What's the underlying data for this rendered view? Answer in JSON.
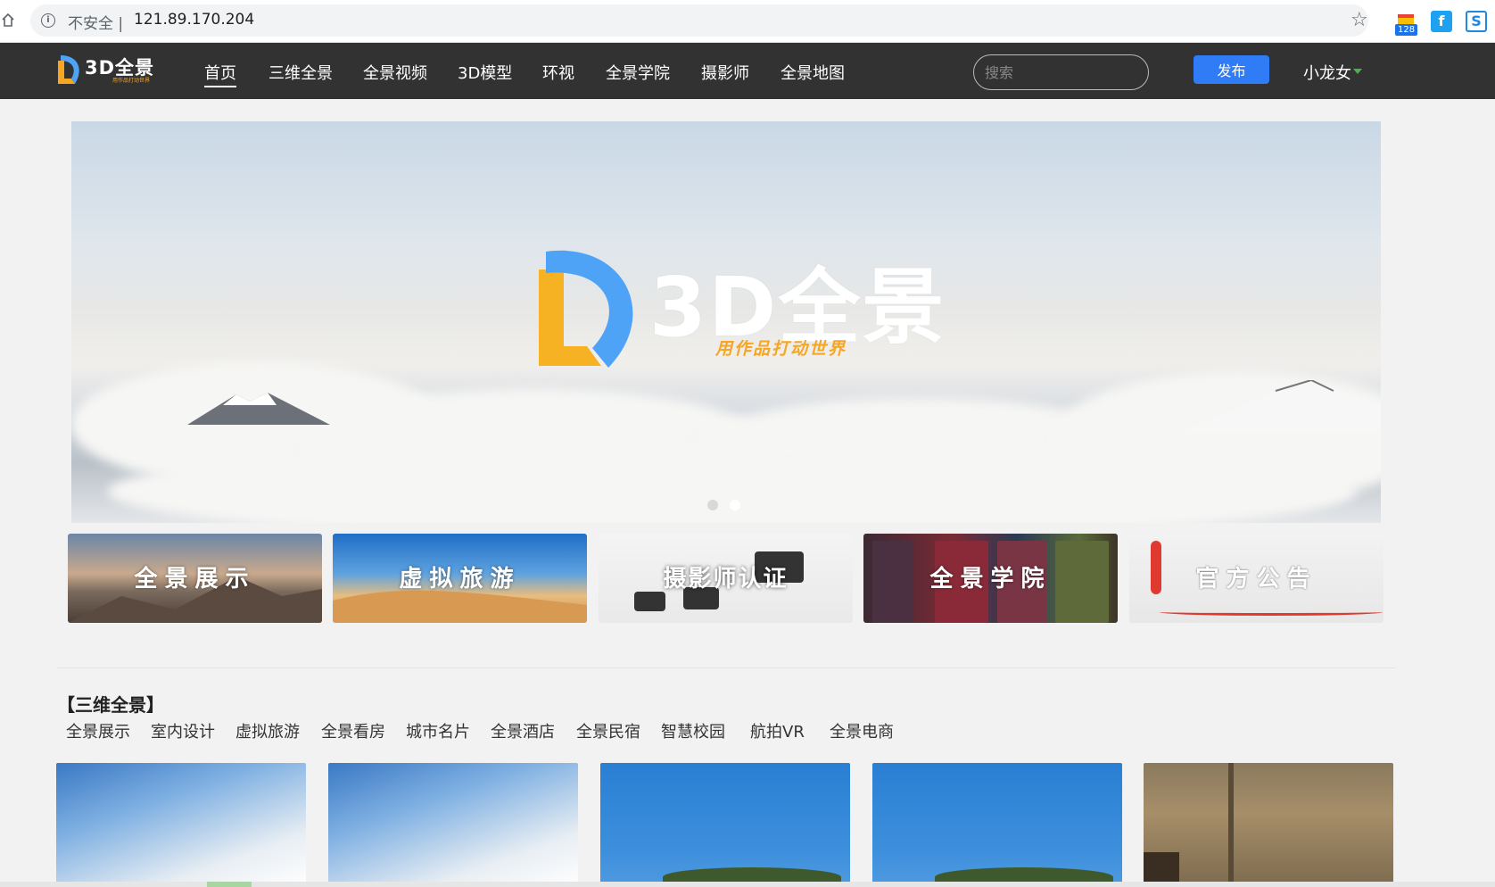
{
  "browser": {
    "security_label": "不安全",
    "separator": "|",
    "url": "121.89.170.204",
    "extension_badge": "128",
    "ext2_glyph": "f",
    "ext3_glyph": "S"
  },
  "site": {
    "logo_text": "3D全景",
    "logo_tagline": "用作品打动世界",
    "nav": [
      {
        "label": "首页",
        "active": true
      },
      {
        "label": "三维全景"
      },
      {
        "label": "全景视频"
      },
      {
        "label": "3D模型"
      },
      {
        "label": "环视"
      },
      {
        "label": "全景学院"
      },
      {
        "label": "摄影师"
      },
      {
        "label": "全景地图"
      }
    ],
    "search_placeholder": "搜索",
    "publish_label": "发布",
    "user_name": "小龙女"
  },
  "banner": {
    "title": "3D全景",
    "subtitle": "用作品打动世界",
    "slide_count": 2,
    "active_slide": 2
  },
  "tiles": [
    {
      "label": "全景展示"
    },
    {
      "label": "虚拟旅游"
    },
    {
      "label": "摄影师认证"
    },
    {
      "label": "全景学院"
    },
    {
      "label": "官方公告"
    }
  ],
  "section": {
    "title": "【三维全景】",
    "subcategories": [
      "全景展示",
      "室内设计",
      "虚拟旅游",
      "全景看房",
      "城市名片",
      "全景酒店",
      "全景民宿",
      "智慧校园",
      "航拍VR",
      "全景电商"
    ]
  },
  "colors": {
    "nav_bg": "#323232",
    "accent_blue": "#2f7cf6",
    "logo_orange": "#f6a623",
    "logo_blue": "#4fa3f7"
  }
}
